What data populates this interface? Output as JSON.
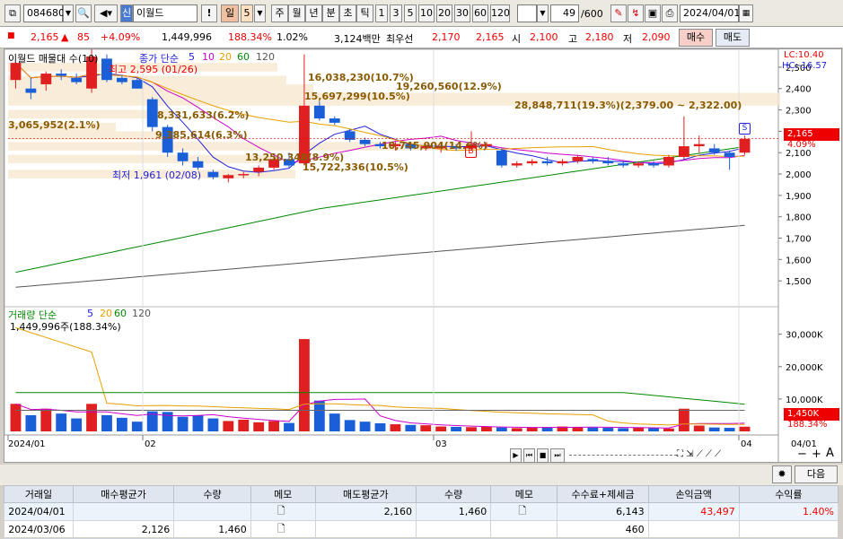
{
  "toolbar": {
    "code": "084680",
    "badge": "신",
    "name": "이월드",
    "period_buttons": [
      "일",
      "5",
      "주",
      "월",
      "년",
      "분",
      "초",
      "틱"
    ],
    "intervals": [
      "1",
      "3",
      "5",
      "10",
      "20",
      "30",
      "60",
      "120"
    ],
    "count": "49",
    "count_total": "/600",
    "date": "2024/04/01"
  },
  "quote": {
    "price": "2,165",
    "change": "85",
    "change_pct": "+4.09%",
    "volume": "1,449,996",
    "volume_ratio": "188.34%",
    "turnover": "1.02%",
    "amount": "3,124백만",
    "best_ask_label": "최우선",
    "best_ask": "2,170",
    "best_bid": "2,165",
    "open_label": "시",
    "open": "2,100",
    "high_label": "고",
    "high": "2,180",
    "low_label": "저",
    "low": "2,090",
    "buy_button": "매수",
    "sell_button": "매도"
  },
  "price_chart": {
    "title": "이월드 매물대 수(10)",
    "ma_label": "종가 단순",
    "ma_periods": [
      "5",
      "10",
      "20",
      "60",
      "120"
    ],
    "ma_colors": [
      "#2222dd",
      "#cc00cc",
      "#e8a000",
      "#008800",
      "#555555"
    ],
    "lc": "LC:10.40",
    "hc": "HC:-16.57",
    "current_price": "2,165",
    "current_pct": "4.09%",
    "high_note": "최고 2,595 (01/26)",
    "low_note": "최저 1,961 (02/08)",
    "ylabels": [
      "2,500",
      "2,400",
      "2,300",
      "2,200",
      "2,100",
      "2,000",
      "1,900",
      "1,800",
      "1,700",
      "1,600",
      "1,500"
    ],
    "volume_profile": [
      "16,038,230(10.7%)",
      "15,697,299(10.5%)",
      "19,260,560(12.9%)",
      "28,848,711(19.3%)(2,379.00 ~ 2,322.00)",
      "8,331,633(6.2%)",
      "3,065,952(2.1%)",
      "9,385,614(6.3%)",
      "10,745,904(14.6%)",
      "13,250,348(8.9%)",
      "15,722,336(10.5%)"
    ],
    "signal_b": "B",
    "signal_s": "S"
  },
  "volume_chart": {
    "title": "거래량 단순",
    "ma_periods": [
      "5",
      "20",
      "60",
      "120"
    ],
    "current": "1,449,996주(188.34%)",
    "ylabels": [
      "30,000K",
      "20,000K",
      "10,000K"
    ],
    "current_vol": "1,450K",
    "current_ratio": "188.34%"
  },
  "xaxis": [
    "2024/01",
    "02",
    "03",
    "04",
    "04/01"
  ],
  "next_button": "다음",
  "table": {
    "headers": [
      "거래일",
      "매수평균가",
      "수량",
      "메모",
      "매도평균가",
      "수량",
      "메모",
      "수수료+제세금",
      "손익금액",
      "수익률"
    ],
    "rows": [
      [
        "2024/04/01",
        "",
        "",
        "",
        "2,160",
        "1,460",
        "",
        "6,143",
        "43,497",
        "1.40%"
      ],
      [
        "2024/03/06",
        "2,126",
        "1,460",
        "",
        "",
        "",
        "",
        "460",
        "",
        ""
      ]
    ]
  },
  "chart_data": {
    "type": "candlestick",
    "x_start": "2024/01",
    "x_end": "2024/04/01",
    "ylim": [
      1400,
      2550
    ],
    "candles": [
      [
        2440,
        2520,
        2400,
        2520
      ],
      [
        2400,
        2450,
        2350,
        2380
      ],
      [
        2420,
        2480,
        2390,
        2470
      ],
      [
        2470,
        2490,
        2440,
        2460
      ],
      [
        2450,
        2470,
        2420,
        2430
      ],
      [
        2400,
        2595,
        2380,
        2550
      ],
      [
        2540,
        2560,
        2430,
        2440
      ],
      [
        2450,
        2460,
        2420,
        2430
      ],
      [
        2440,
        2450,
        2400,
        2400
      ],
      [
        2350,
        2360,
        2200,
        2220
      ],
      [
        2220,
        2230,
        2080,
        2100
      ],
      [
        2100,
        2120,
        2040,
        2060
      ],
      [
        2060,
        2080,
        2020,
        2030
      ],
      [
        2010,
        2020,
        1975,
        1985
      ],
      [
        1980,
        2000,
        1961,
        1995
      ],
      [
        1995,
        2010,
        1980,
        2000
      ],
      [
        2010,
        2040,
        1990,
        2030
      ],
      [
        2030,
        2080,
        2020,
        2070
      ],
      [
        2070,
        2100,
        2030,
        2040
      ],
      [
        2050,
        2560,
        2040,
        2320
      ],
      [
        2320,
        2340,
        2250,
        2260
      ],
      [
        2260,
        2270,
        2230,
        2240
      ],
      [
        2200,
        2210,
        2150,
        2160
      ],
      [
        2160,
        2170,
        2130,
        2140
      ],
      [
        2140,
        2150,
        2120,
        2130
      ],
      [
        2130,
        2150,
        2110,
        2140
      ],
      [
        2140,
        2150,
        2110,
        2120
      ],
      [
        2120,
        2140,
        2110,
        2130
      ],
      [
        2120,
        2140,
        2100,
        2130
      ],
      [
        2130,
        2140,
        2110,
        2120
      ],
      [
        2120,
        2200,
        2110,
        2140
      ],
      [
        2130,
        2150,
        2120,
        2140
      ],
      [
        2110,
        2120,
        2030,
        2040
      ],
      [
        2040,
        2060,
        2030,
        2050
      ],
      [
        2050,
        2070,
        2040,
        2060
      ],
      [
        2060,
        2080,
        2040,
        2050
      ],
      [
        2050,
        2070,
        2040,
        2060
      ],
      [
        2060,
        2090,
        2050,
        2080
      ],
      [
        2070,
        2080,
        2050,
        2060
      ],
      [
        2060,
        2080,
        2040,
        2050
      ],
      [
        2050,
        2060,
        2030,
        2040
      ],
      [
        2040,
        2060,
        2030,
        2050
      ],
      [
        2050,
        2060,
        2030,
        2040
      ],
      [
        2040,
        2090,
        2030,
        2080
      ],
      [
        2080,
        2270,
        2070,
        2130
      ],
      [
        2130,
        2180,
        2100,
        2140
      ],
      [
        2120,
        2140,
        2090,
        2100
      ],
      [
        2100,
        2110,
        2020,
        2080
      ],
      [
        2100,
        2180,
        2090,
        2165
      ]
    ],
    "volume_k": [
      8500,
      5000,
      7000,
      5500,
      4000,
      8500,
      5000,
      4200,
      3000,
      6200,
      6000,
      4500,
      5000,
      4000,
      3200,
      3600,
      2800,
      3200,
      2600,
      28500,
      9500,
      5500,
      3500,
      3000,
      2500,
      2200,
      2000,
      1900,
      1500,
      1400,
      1300,
      1400,
      1200,
      1000,
      1200,
      1300,
      1500,
      1300,
      1200,
      1100,
      1000,
      1200,
      1100,
      900,
      7000,
      1800,
      1200,
      1100,
      1450
    ]
  }
}
